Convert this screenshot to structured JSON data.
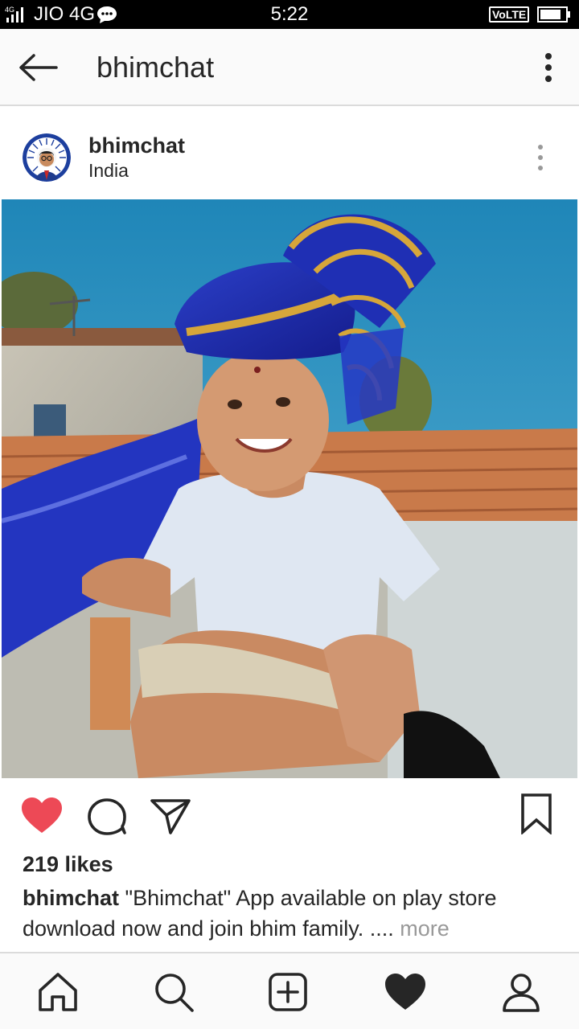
{
  "status_bar": {
    "network": "4G",
    "carrier": "JIO 4G",
    "time": "5:22",
    "volte": "VoLTE",
    "icons": [
      "signal-icon",
      "chat-notification-icon",
      "battery-icon"
    ]
  },
  "header": {
    "title": "bhimchat",
    "icons": [
      "back-arrow-icon",
      "more-vertical-icon"
    ]
  },
  "post": {
    "username": "bhimchat",
    "location": "India",
    "likes": "219 likes",
    "caption_user": "bhimchat",
    "caption_text": " \"Bhimchat\" App available on play store download now and join bhim family. ....",
    "caption_more": " more",
    "liked": true,
    "colors": {
      "like": "#ed4956",
      "text": "#262626",
      "muted": "#999999"
    }
  },
  "bottom_nav": {
    "items": [
      "home-icon",
      "search-icon",
      "add-post-icon",
      "activity-heart-icon",
      "profile-icon"
    ],
    "active": "activity-heart-icon"
  }
}
